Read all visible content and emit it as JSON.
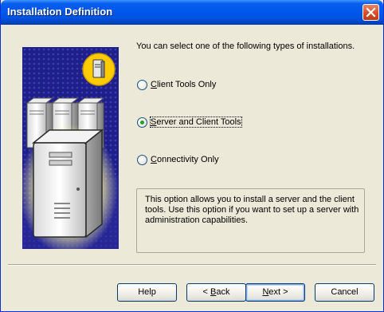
{
  "window": {
    "title": "Installation Definition",
    "close_label": "Close"
  },
  "intro_text": "You can select one of the following types of installations.",
  "options": [
    {
      "label_pre": "",
      "mnemonic": "C",
      "label_post": "lient Tools Only",
      "selected": false
    },
    {
      "label_pre": "",
      "mnemonic": "S",
      "label_post": "erver and Client Tools",
      "selected": true
    },
    {
      "label_pre": "",
      "mnemonic": "C",
      "label_post": "onnectivity Only",
      "selected": false
    }
  ],
  "description": "This option allows you to install a server and the client tools. Use this option if you want to set up a server with administration capabilities.",
  "buttons": {
    "help": {
      "pre": "Help",
      "mn": "",
      "post": ""
    },
    "back": {
      "pre": "< ",
      "mn": "B",
      "post": "ack"
    },
    "next": {
      "pre": "",
      "mn": "N",
      "post": "ext >"
    },
    "cancel": {
      "pre": "Cancel",
      "mn": "",
      "post": ""
    }
  },
  "colors": {
    "title_bar": "#0054e3",
    "dialog_bg": "#ece9d8",
    "panel_bg": "#1f1f8a",
    "badge_yellow": "#ffcc00",
    "radio_dot": "#21a121"
  },
  "icons": [
    "close-icon",
    "server-icon",
    "server-rack-icon",
    "server-tower-icon"
  ]
}
